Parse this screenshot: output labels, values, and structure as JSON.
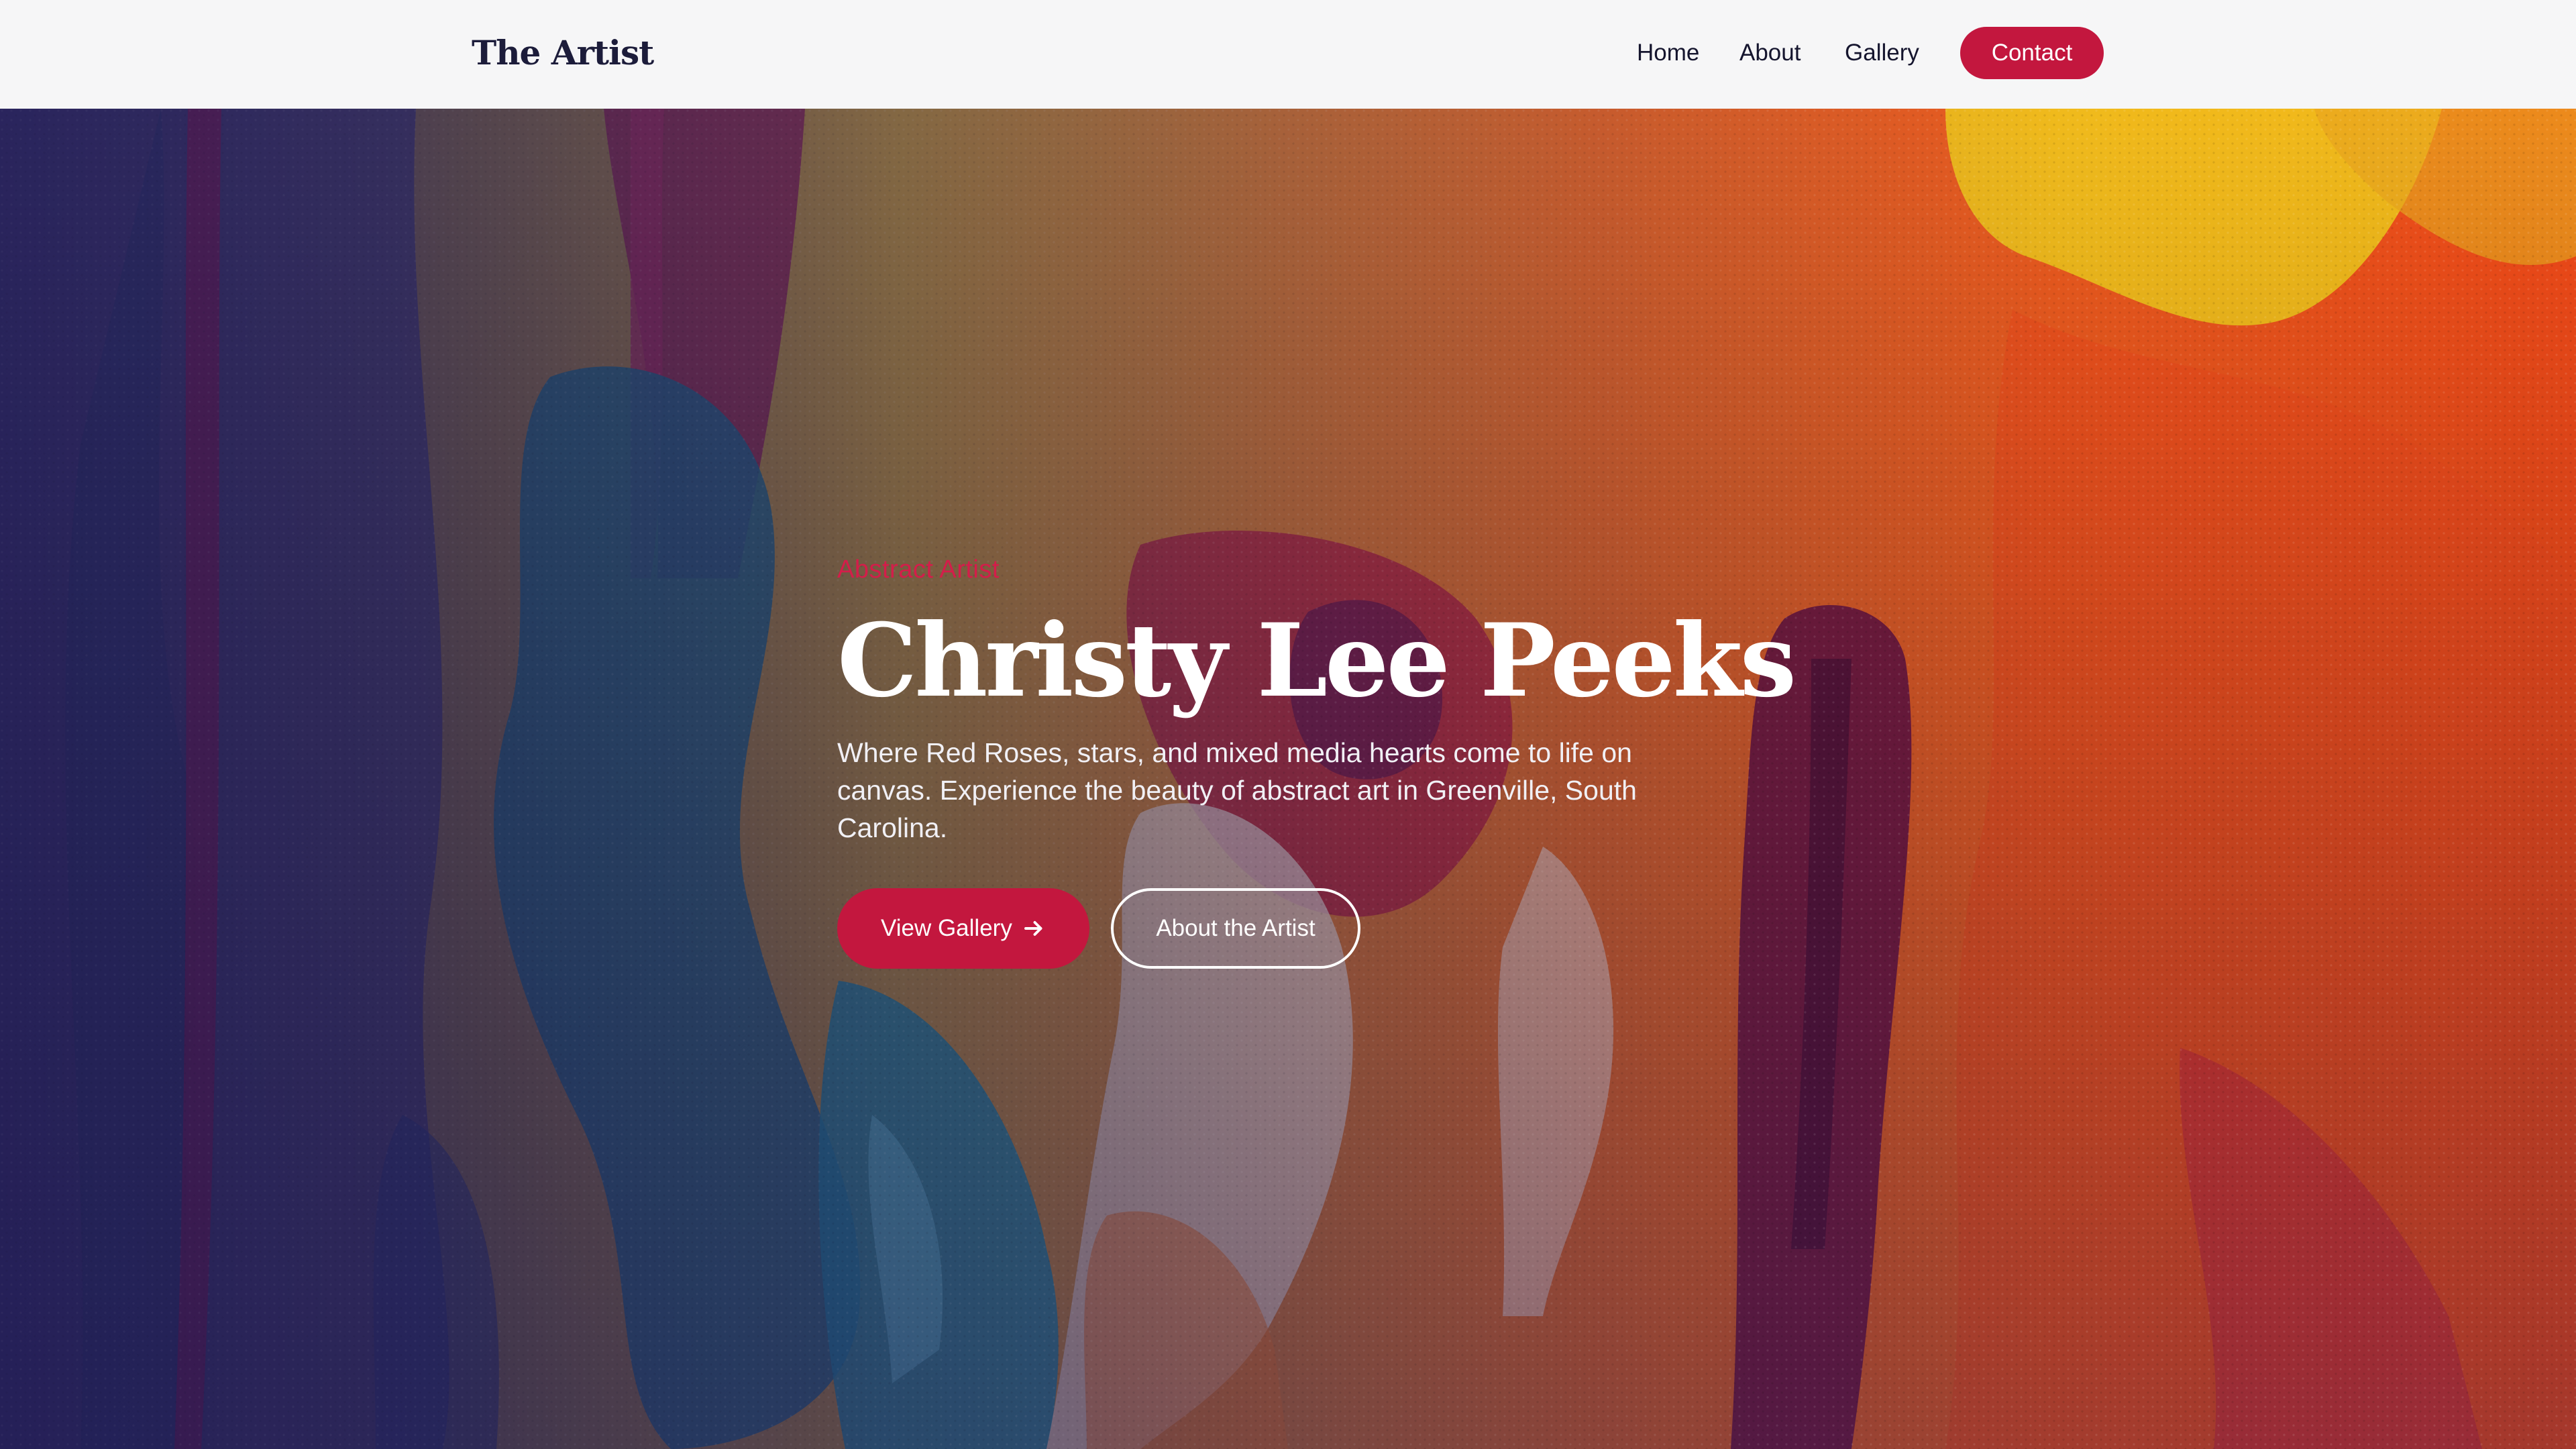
{
  "nav": {
    "brand": "The Artist",
    "links": [
      {
        "label": "Home"
      },
      {
        "label": "About"
      },
      {
        "label": "Gallery"
      }
    ],
    "contact_label": "Contact"
  },
  "hero": {
    "eyebrow": "Abstract Artist",
    "title": "Christy Lee Peeks",
    "description": "Where Red Roses, stars, and mixed media hearts come to life on canvas. Experience the beauty of abstract art in Greenville, South Carolina.",
    "primary_button": {
      "label": "View Gallery",
      "icon": "arrow-right-icon"
    },
    "secondary_button": {
      "label": "About the Artist"
    }
  },
  "colors": {
    "accent": "#c3173e",
    "nav_background": "#f6f6f7",
    "brand_text": "#1c1c3a",
    "eyebrow_text": "#d41d4a"
  }
}
